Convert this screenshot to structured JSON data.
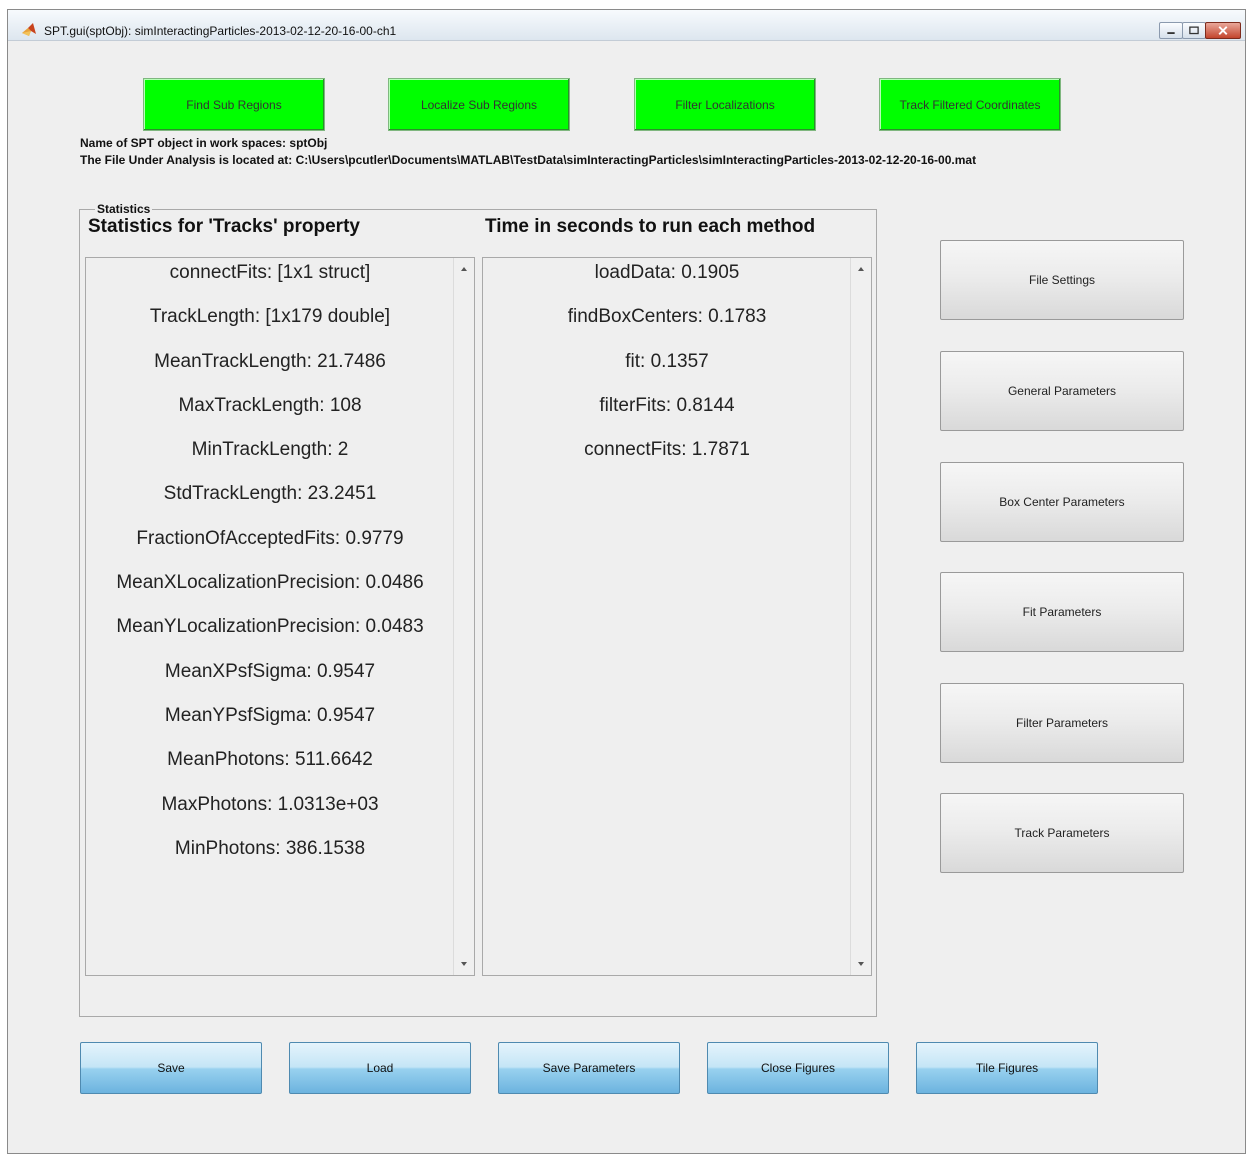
{
  "window": {
    "title": "SPT.gui(sptObj): simInteractingParticles-2013-02-12-20-16-00-ch1"
  },
  "top_buttons": [
    {
      "label": "Find Sub Regions"
    },
    {
      "label": "Localize Sub Regions"
    },
    {
      "label": "Filter Localizations"
    },
    {
      "label": "Track Filtered Coordinates"
    }
  ],
  "info": {
    "object_name_line": "Name of SPT object in work spaces: sptObj",
    "file_location_line": "The File Under Analysis is located at: C:\\Users\\pcutler\\Documents\\MATLAB\\TestData\\simInteractingParticles\\simInteractingParticles-2013-02-12-20-16-00.mat"
  },
  "statistics": {
    "group_label": "Statistics",
    "tracks_header": "Statistics for 'Tracks' property",
    "timing_header": "Time in seconds to run each method",
    "tracks_items": [
      "connectFits: [1x1 struct]",
      "TrackLength: [1x179 double]",
      "MeanTrackLength: 21.7486",
      "MaxTrackLength: 108",
      "MinTrackLength: 2",
      "StdTrackLength: 23.2451",
      "FractionOfAcceptedFits: 0.9779",
      "MeanXLocalizationPrecision: 0.0486",
      "MeanYLocalizationPrecision: 0.0483",
      "MeanXPsfSigma: 0.9547",
      "MeanYPsfSigma: 0.9547",
      "MeanPhotons: 511.6642",
      "MaxPhotons: 1.0313e+03",
      "MinPhotons: 386.1538"
    ],
    "timing_items": [
      "loadData: 0.1905",
      "findBoxCenters: 0.1783",
      "fit: 0.1357",
      "filterFits: 0.8144",
      "connectFits: 1.7871"
    ]
  },
  "side_buttons": [
    {
      "label": "File Settings"
    },
    {
      "label": "General Parameters"
    },
    {
      "label": "Box Center Parameters"
    },
    {
      "label": "Fit Parameters"
    },
    {
      "label": "Filter Parameters"
    },
    {
      "label": "Track Parameters"
    }
  ],
  "bottom_buttons": [
    {
      "label": "Save"
    },
    {
      "label": "Load"
    },
    {
      "label": "Save Parameters"
    },
    {
      "label": "Close Figures"
    },
    {
      "label": "Tile Figures"
    }
  ],
  "colors": {
    "action_green": "#00ff00",
    "window_bg": "#efefef",
    "blue_button": "#98d1ef"
  },
  "icons": [
    "matlab-icon",
    "minimize-icon",
    "maximize-icon",
    "close-icon",
    "scroll-up-icon",
    "scroll-down-icon"
  ]
}
